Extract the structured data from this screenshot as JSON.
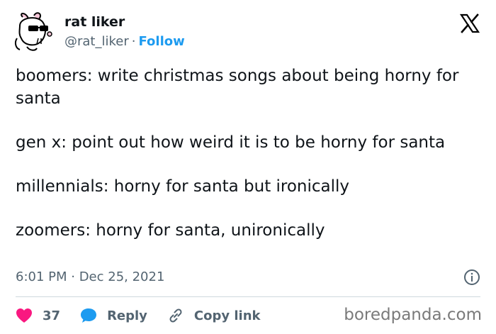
{
  "tweet": {
    "display_name": "rat liker",
    "handle": "@rat_liker",
    "separator": "·",
    "follow_label": "Follow",
    "paragraphs": [
      "boomers: write christmas songs about being horny for santa",
      "gen x: point out how weird it is to be horny for santa",
      "millennials: horny for santa but ironically",
      "zoomers: horny for santa, unironically"
    ],
    "time": "6:01 PM · Dec 25, 2021"
  },
  "actions": {
    "like_count": "37",
    "reply_label": "Reply",
    "copy_link_label": "Copy link"
  },
  "watermark": "boredpanda.com",
  "colors": {
    "like": "#f91880",
    "accent": "#1d9bf0",
    "muted": "#536471",
    "divider": "#cfd9de"
  },
  "icons": [
    "rat-avatar-icon",
    "x-logo-icon",
    "info-icon",
    "heart-icon",
    "reply-bubble-icon",
    "link-icon"
  ]
}
